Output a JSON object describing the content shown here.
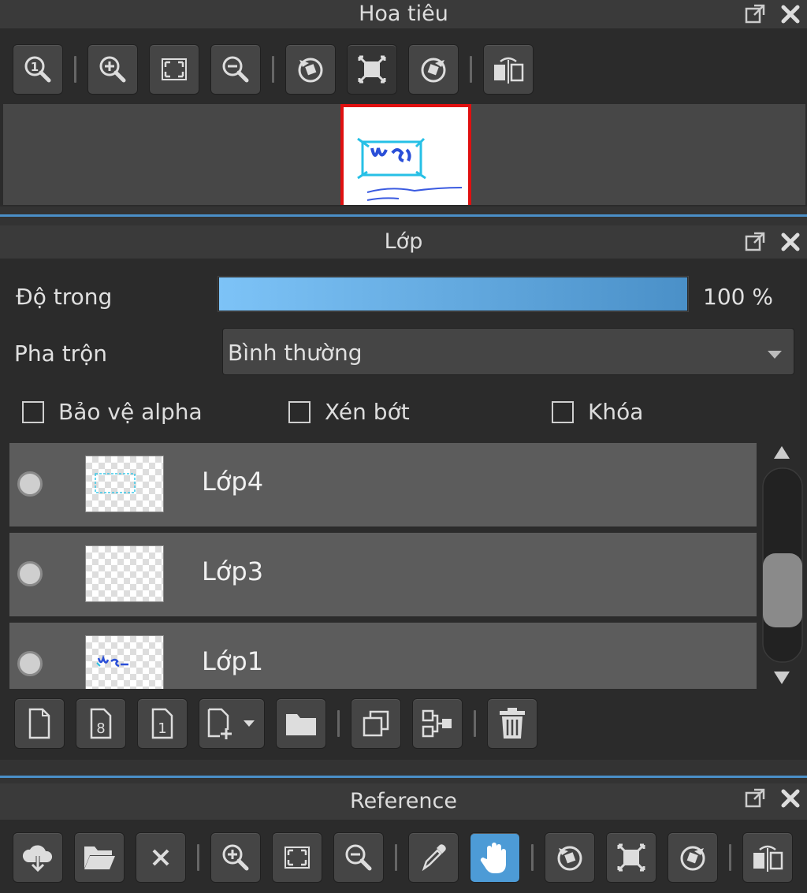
{
  "navigator": {
    "title": "Hoa tiêu",
    "buttons": [
      "zoom-actual-icon",
      "zoom-in-icon",
      "fit-screen-icon",
      "zoom-out-icon",
      "rotate-left-icon",
      "fit-window-icon",
      "rotate-right-icon",
      "flip-horizontal-icon"
    ]
  },
  "layers": {
    "title": "Lớp",
    "opacity_label": "Độ trong",
    "opacity_value": "100 %",
    "opacity_fraction": 1.0,
    "blend_label": "Pha trộn",
    "blend_value": "Bình thường",
    "checks": {
      "protect_alpha": "Bảo vệ alpha",
      "clipping": "Xén bớt",
      "lock": "Khóa"
    },
    "items": [
      {
        "name": "Lớp4"
      },
      {
        "name": "Lớp3"
      },
      {
        "name": "Lớp1"
      }
    ],
    "buttons": [
      "new-layer-icon",
      "new-8bit-layer-icon",
      "new-1bit-layer-icon",
      "add-layer-menu-icon",
      "folder-icon",
      "duplicate-icon",
      "merge-down-icon",
      "trash-icon"
    ]
  },
  "reference": {
    "title": "Reference",
    "buttons": [
      "cloud-download-icon",
      "open-folder-icon",
      "close-icon",
      "zoom-in-icon",
      "fit-screen-icon",
      "zoom-out-icon",
      "eyedropper-icon",
      "hand-icon",
      "rotate-left-icon",
      "fit-window-icon",
      "rotate-right-icon",
      "flip-horizontal-icon"
    ]
  },
  "colors": {
    "accent": "#4a8fc8",
    "slider_start": "#7dc3f7",
    "slider_end": "#4a90c8",
    "hand_active": "#4d9bd6"
  }
}
